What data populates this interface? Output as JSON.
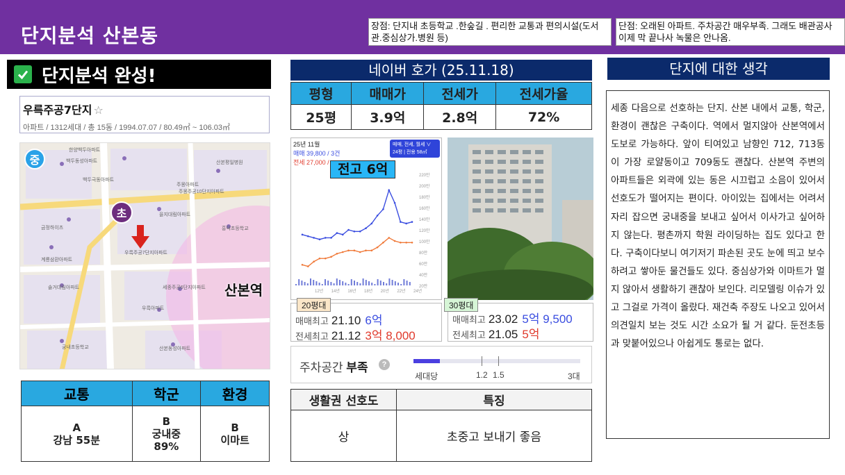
{
  "header": {
    "title": "단지분석 산본동",
    "pros": "장점: 단지내 초등학교 .한숲길 . 편리한 교통과 편의시설(도서관.중심상가.병원 등)",
    "cons": "단점: 오래된 아파트. 주차공간 매우부족. 그래도 배관공사 이제 막 끝나사 녹물은 안나옴."
  },
  "banner": {
    "text": "단지분석 완성!"
  },
  "complex": {
    "name": "우륵주공7단지",
    "meta": "아파트 / 1312세대 / 총 15동 / 1994.07.07 / 80.49㎡ ~ 106.03㎡"
  },
  "map": {
    "badge_jung": "중",
    "badge_cho": "초",
    "station": "산본역",
    "labels": [
      "한양백두아파트",
      "백두동성아파트",
      "백두극동아파트",
      "주몽아파트",
      "주몽주공10단지아파트",
      "산본평일병원",
      "설악아파트",
      "우륵주공7단지아파트",
      "세종주공6단지아파트",
      "궁내초등학교",
      "흥덕초등학교",
      "우륵아파트",
      "산본동성아파트",
      "솔거대림아파트",
      "을지대림아파트",
      "금정하이츠",
      "계룡삼환아파트"
    ]
  },
  "grades": {
    "headers": [
      "교통",
      "학군",
      "환경"
    ],
    "values": [
      [
        "A",
        "강남 55분"
      ],
      [
        "B",
        "궁내중",
        "89%"
      ],
      [
        "B",
        "이마트"
      ]
    ]
  },
  "naver": {
    "title": "네이버 호가 (25.11.18)",
    "headers": [
      "평형",
      "매매가",
      "전세가",
      "전세가율"
    ],
    "row": [
      "25평",
      "3.9억",
      "2.8억",
      "72%"
    ]
  },
  "chart": {
    "date_label": "25년 11월",
    "sale_label": "매매 39,800 / 3건",
    "jeonse_label": "전세 27,000 /",
    "filter_line1": "매매, 전세, 월세 ∨",
    "filter_line2": "24평 | 전용 58㎡",
    "callout": "전고 6억",
    "sale_color": "#3a4de0",
    "jeonse_color": "#f07a3a"
  },
  "chart_data": {
    "type": "line",
    "title": "",
    "yticks": [
      "220만",
      "200만",
      "180만",
      "160만",
      "140만",
      "120만",
      "100만",
      "80만",
      "60만",
      "40만",
      "20만"
    ],
    "xticks": [
      "12년",
      "14년",
      "16년",
      "18년",
      "20년",
      "22년",
      "24년"
    ],
    "series": [
      {
        "name": "매매",
        "values": [
          32,
          31,
          30,
          29,
          30,
          30,
          33,
          32,
          35,
          34,
          34,
          36,
          39,
          44,
          48,
          60,
          52,
          40,
          39,
          40
        ]
      },
      {
        "name": "전세",
        "values": [
          13,
          12,
          15,
          17,
          17,
          18,
          20,
          21,
          22,
          22,
          21,
          22,
          22,
          24,
          27,
          30,
          28,
          27,
          27,
          27
        ]
      }
    ]
  },
  "records": {
    "r20": {
      "tag": "20평대",
      "sale_label": "매매최고",
      "sale_date": "21.10",
      "sale_value": "6억",
      "jeonse_label": "전세최고",
      "jeonse_date": "21.12",
      "jeonse_value": "3억 8,000"
    },
    "r30": {
      "tag": "30평대",
      "sale_label": "매매최고",
      "sale_date": "23.02",
      "sale_value": "5억 9,500",
      "jeonse_label": "전세최고",
      "jeonse_date": "21.05",
      "jeonse_value": "5억"
    }
  },
  "parking": {
    "label": "주차공간",
    "status": "부족",
    "help": "?",
    "ratio": 0.16,
    "left_label": "세대당",
    "tick_labels": [
      "1.2",
      "1.5"
    ],
    "max_label": "3대"
  },
  "preference": {
    "headers": [
      "생활권 선호도",
      "특징"
    ],
    "row": [
      "상",
      "초중고 보내기 좋음"
    ]
  },
  "thoughts": {
    "title": "단지에 대한 생각",
    "body": "세종 다음으로 선호하는 단지. 산본 내에서 교통, 학군, 환경이 괜찮은 구축이다. 역에서 멀지않아 산본역에서 도보로 가능하다. 앞이 티여있고 남향인 712, 713동이 가장 로얄동이고 709동도 괜찮다. 산본역 주변의 아파트들은 외곽에 있는 동은 시끄럽고 소음이 있어서 선호도가 떨어지는 편이다. 아이있는 집에서는 어려서 자리 잡으면 궁내중을 보내고 싶어서 이사가고 싶어하지 않는다. 평촌까지 학원 라이딩하는 집도 있다고 한다. 구축이다보니 여기저기 파손된 곳도 눈에 띄고 보수하려고 쌓아둔 물건들도 있다. 중심상가와 이마트가 멀지 않아서 생활하기 괜찮아 보인다. 리모델링 이슈가 있고 그걸로 가격이 올랐다. 재건축 주장도 나오고 있어서 의견일치 보는 것도 시간 소요가 될 거 같다. 둔전초등과 맞붙어있으나 아쉽게도 통로는 없다."
  }
}
